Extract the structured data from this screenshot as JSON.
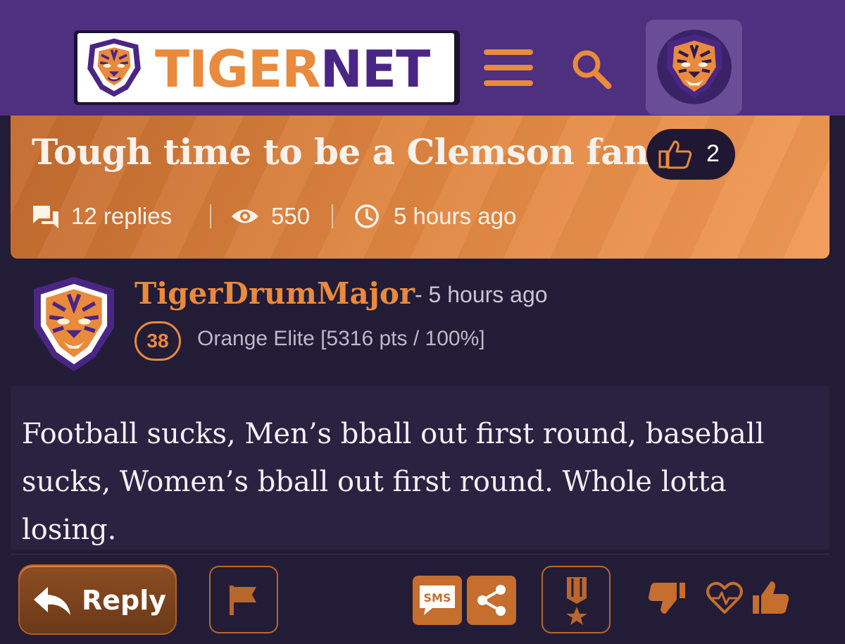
{
  "header": {
    "logo_tiger": "TIGER",
    "logo_net": "NET",
    "icons": [
      "tiger-logo-icon",
      "menu-icon",
      "search-icon",
      "user-avatar-icon"
    ]
  },
  "thread": {
    "title": "Tough time to be a Clemson fan",
    "like_count": "2",
    "replies": "12 replies",
    "views": "550",
    "posted": "5 hours ago"
  },
  "post": {
    "username": "TigerDrumMajor",
    "time": "- 5 hours ago",
    "level": "38",
    "rank": "Orange Elite [5316 pts / 100%]",
    "body": "Football sucks, Men’s bball out first round, baseball sucks, Women’s bball out first round. Whole lotta losing."
  },
  "actions": {
    "reply_label": "Reply",
    "sms_label": "SMS",
    "icons": [
      "reply-arrow-icon",
      "flag-icon",
      "sms-icon",
      "share-icon",
      "award-medal-icon",
      "thumbs-down-icon",
      "heart-icon",
      "thumbs-up-icon"
    ]
  },
  "colors": {
    "header_bg": "#4e2f80",
    "accent_orange": "#e98a3c",
    "brand_purple": "#4a2684",
    "page_bg": "#231c36",
    "post_body_bg": "#2a2240"
  }
}
